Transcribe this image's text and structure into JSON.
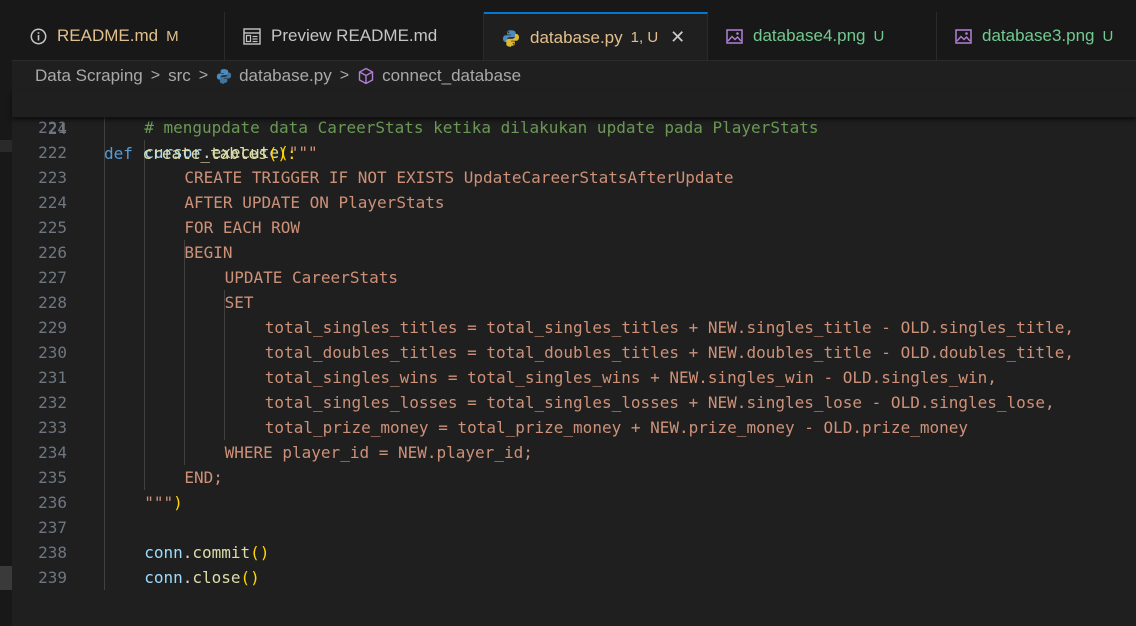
{
  "tabs": [
    {
      "label": "README.md",
      "badge": "M",
      "icon": "info-icon",
      "label_color": "#e2c08d",
      "badge_color": "#e2c08d"
    },
    {
      "label": "Preview README.md",
      "badge": "",
      "icon": "preview-icon",
      "label_color": "#c5c5c5",
      "badge_color": "#c5c5c5"
    },
    {
      "label": "database.py",
      "badge": "1, U",
      "icon": "python-icon",
      "label_color": "#e2c08d",
      "badge_color": "#e2c08d",
      "close": "✕",
      "active": true
    },
    {
      "label": "database4.png",
      "badge": "U",
      "icon": "image-icon",
      "label_color": "#73c991",
      "badge_color": "#73c991"
    },
    {
      "label": "database3.png",
      "badge": "U",
      "icon": "image-icon",
      "label_color": "#73c991",
      "badge_color": "#73c991"
    }
  ],
  "breadcrumb": {
    "items": [
      "Data Scraping",
      "src",
      "database.py",
      "connect_database"
    ],
    "separator": ">"
  },
  "editor": {
    "sticky": {
      "number": "24",
      "keyword": "def",
      "function": "create_tables",
      "suffix": "():"
    },
    "lines": [
      {
        "n": "221",
        "parts": [
          {
            "t": "# mengupdate data CareerStats ketika dilakukan update pada PlayerStats",
            "c": "cm"
          }
        ]
      },
      {
        "n": "222",
        "parts": [
          {
            "t": "cursor",
            "c": "vr"
          },
          {
            "t": ".",
            "c": "pl"
          },
          {
            "t": "execute",
            "c": "fn"
          },
          {
            "t": "(",
            "c": "br"
          },
          {
            "t": "\"\"\"",
            "c": "st"
          }
        ]
      },
      {
        "n": "223",
        "parts": [
          {
            "t": "CREATE TRIGGER IF NOT EXISTS UpdateCareerStatsAfterUpdate",
            "c": "st"
          }
        ]
      },
      {
        "n": "224",
        "parts": [
          {
            "t": "AFTER UPDATE ON PlayerStats",
            "c": "st"
          }
        ]
      },
      {
        "n": "225",
        "parts": [
          {
            "t": "FOR EACH ROW",
            "c": "st"
          }
        ]
      },
      {
        "n": "226",
        "parts": [
          {
            "t": "BEGIN",
            "c": "st"
          }
        ]
      },
      {
        "n": "227",
        "parts": [
          {
            "t": "UPDATE CareerStats",
            "c": "st"
          }
        ]
      },
      {
        "n": "228",
        "parts": [
          {
            "t": "SET",
            "c": "st"
          }
        ]
      },
      {
        "n": "229",
        "parts": [
          {
            "t": "total_singles_titles = total_singles_titles + NEW.singles_title - OLD.singles_title,",
            "c": "st"
          }
        ]
      },
      {
        "n": "230",
        "parts": [
          {
            "t": "total_doubles_titles = total_doubles_titles + NEW.doubles_title - OLD.doubles_title,",
            "c": "st"
          }
        ]
      },
      {
        "n": "231",
        "parts": [
          {
            "t": "total_singles_wins = total_singles_wins + NEW.singles_win - OLD.singles_win,",
            "c": "st"
          }
        ]
      },
      {
        "n": "232",
        "parts": [
          {
            "t": "total_singles_losses = total_singles_losses + NEW.singles_lose - OLD.singles_lose,",
            "c": "st"
          }
        ]
      },
      {
        "n": "233",
        "parts": [
          {
            "t": "total_prize_money = total_prize_money + NEW.prize_money - OLD.prize_money",
            "c": "st"
          }
        ]
      },
      {
        "n": "234",
        "parts": [
          {
            "t": "WHERE player_id = NEW.player_id;",
            "c": "st"
          }
        ]
      },
      {
        "n": "235",
        "parts": [
          {
            "t": "END;",
            "c": "st"
          }
        ]
      },
      {
        "n": "236",
        "parts": [
          {
            "t": "\"\"\"",
            "c": "st"
          },
          {
            "t": ")",
            "c": "br"
          }
        ]
      },
      {
        "n": "237",
        "parts": []
      },
      {
        "n": "238",
        "parts": [
          {
            "t": "conn",
            "c": "vr"
          },
          {
            "t": ".",
            "c": "pl"
          },
          {
            "t": "commit",
            "c": "fn"
          },
          {
            "t": "()",
            "c": "br"
          }
        ]
      },
      {
        "n": "239",
        "parts": [
          {
            "t": "conn",
            "c": "vr"
          },
          {
            "t": ".",
            "c": "pl"
          },
          {
            "t": "close",
            "c": "fn"
          },
          {
            "t": "()",
            "c": "br"
          }
        ]
      }
    ]
  }
}
